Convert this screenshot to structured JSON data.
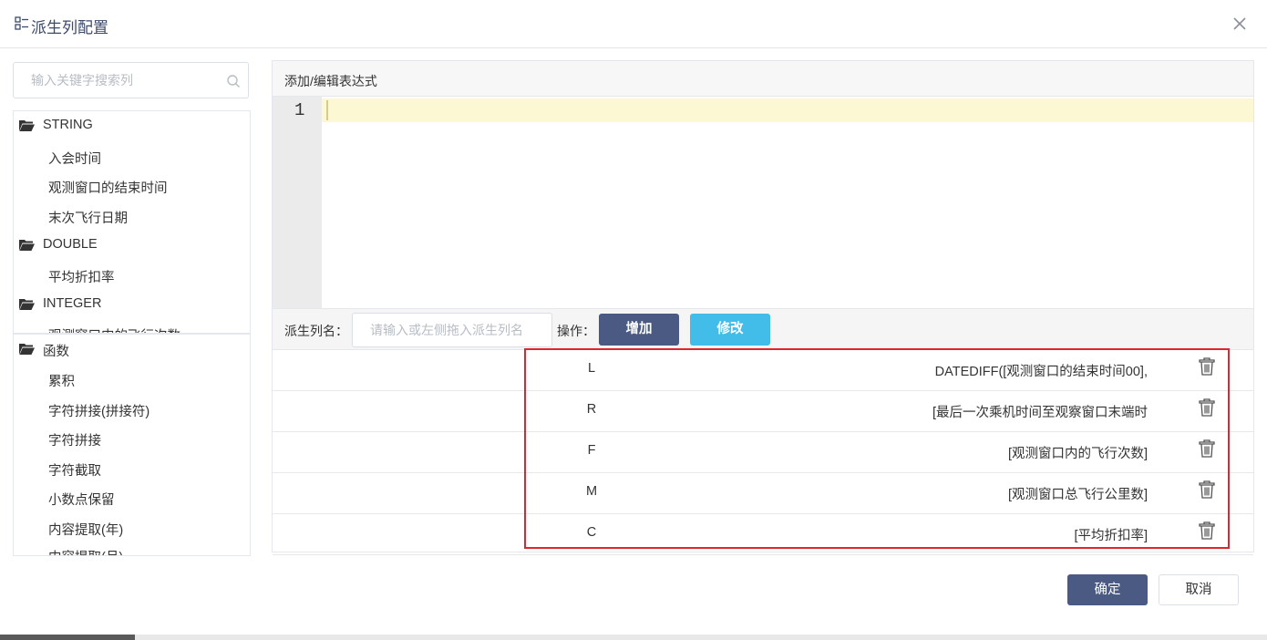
{
  "dialog": {
    "title": "派生列配置",
    "title_icon": "config-icon",
    "close_icon": "close-icon"
  },
  "search": {
    "placeholder": "输入关键字搜索列",
    "icon": "search-icon"
  },
  "columns": {
    "groups": [
      {
        "label": "STRING",
        "items": [
          "入会时间",
          "观测窗口的结束时间",
          "末次飞行日期"
        ]
      },
      {
        "label": "DOUBLE",
        "items": [
          "平均折扣率"
        ]
      },
      {
        "label": "INTEGER",
        "items": [
          "观测窗口内的飞行次数"
        ]
      }
    ]
  },
  "functions": {
    "label": "函数",
    "items": [
      "累积",
      "字符拼接(拼接符)",
      "字符拼接",
      "字符截取",
      "小数点保留",
      "内容提取(年)",
      "内容提取(月)"
    ]
  },
  "editor": {
    "heading": "添加/编辑表达式",
    "line_number": "1"
  },
  "name_row": {
    "label": "派生列名：",
    "placeholder": "请输入或左侧拖入派生列名",
    "op_label": "操作：",
    "add_label": "增加",
    "edit_label": "修改"
  },
  "derived": [
    {
      "name": "L",
      "expr": "DATEDIFF([观测窗口的结束时间00],"
    },
    {
      "name": "R",
      "expr": "[最后一次乘机时间至观察窗口末端时"
    },
    {
      "name": "F",
      "expr": "[观测窗口内的飞行次数]"
    },
    {
      "name": "M",
      "expr": "[观测窗口总飞行公里数]"
    },
    {
      "name": "C",
      "expr": "[平均折扣率]"
    }
  ],
  "footer": {
    "ok_label": "确定",
    "cancel_label": "取消"
  },
  "colors": {
    "primary": "#4a5a82",
    "info": "#42bde9",
    "highlight": "#e0262b",
    "active_line": "#fdf8d4"
  }
}
